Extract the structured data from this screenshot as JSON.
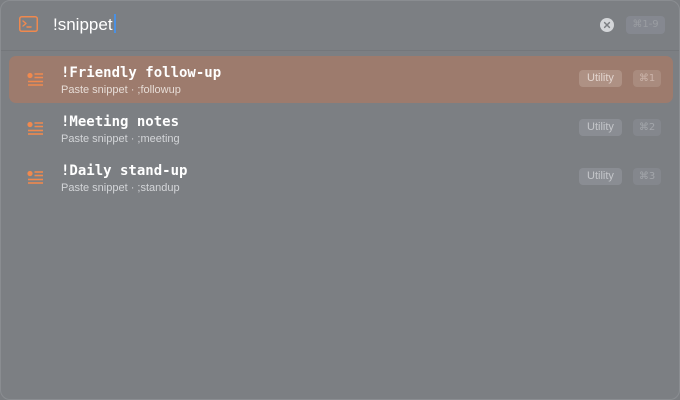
{
  "search": {
    "query": "!snippet",
    "range_shortcut": "⌘1-9"
  },
  "colors": {
    "accent": "#f0894e",
    "selected_row": "#9d7b6d",
    "caret": "#4a90e2"
  },
  "icons": {
    "app": "terminal-icon",
    "clear": "clear-icon",
    "snippet": "snippet-icon"
  },
  "results": [
    {
      "title": "!Friendly follow-up",
      "subtitle": "Paste snippet · ;followup",
      "tag": "Utility",
      "shortcut": "⌘1",
      "selected": true
    },
    {
      "title": "!Meeting notes",
      "subtitle": "Paste snippet · ;meeting",
      "tag": "Utility",
      "shortcut": "⌘2",
      "selected": false
    },
    {
      "title": "!Daily stand-up",
      "subtitle": "Paste snippet · ;standup",
      "tag": "Utility",
      "shortcut": "⌘3",
      "selected": false
    }
  ]
}
